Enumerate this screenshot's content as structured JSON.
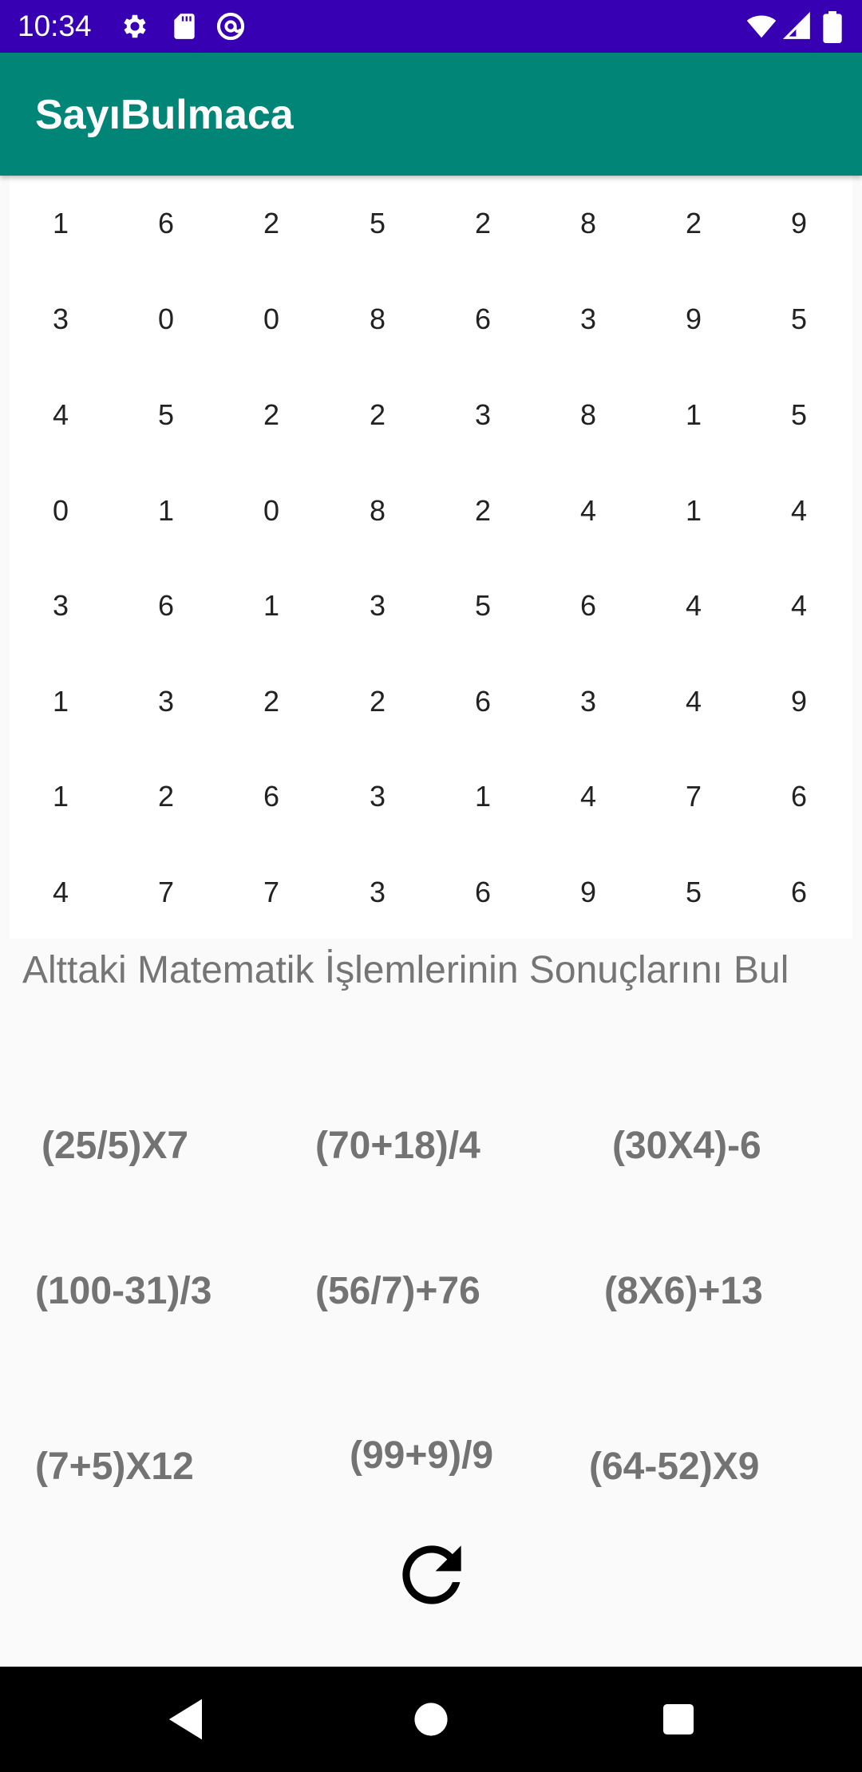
{
  "status_bar": {
    "time": "10:34",
    "left_icons": [
      "gear-icon",
      "sd-card-icon",
      "at-sign-icon"
    ],
    "right_icons": [
      "wifi-icon",
      "signal-icon",
      "battery-icon"
    ],
    "background": "#3700b3"
  },
  "app_bar": {
    "title": "SayıBulmaca",
    "background": "#008577"
  },
  "grid": {
    "rows": [
      [
        "1",
        "6",
        "2",
        "5",
        "2",
        "8",
        "2",
        "9"
      ],
      [
        "3",
        "0",
        "0",
        "8",
        "6",
        "3",
        "9",
        "5"
      ],
      [
        "4",
        "5",
        "2",
        "2",
        "3",
        "8",
        "1",
        "5"
      ],
      [
        "0",
        "1",
        "0",
        "8",
        "2",
        "4",
        "1",
        "4"
      ],
      [
        "3",
        "6",
        "1",
        "3",
        "5",
        "6",
        "4",
        "4"
      ],
      [
        "1",
        "3",
        "2",
        "2",
        "6",
        "3",
        "4",
        "9"
      ],
      [
        "1",
        "2",
        "6",
        "3",
        "1",
        "4",
        "7",
        "6"
      ],
      [
        "4",
        "7",
        "7",
        "3",
        "6",
        "9",
        "5",
        "6"
      ]
    ]
  },
  "instruction": "Alttaki Matematik İşlemlerinin Sonuçlarını Bul",
  "expressions": [
    "(25/5)X7",
    "(70+18)/4",
    "(30X4)-6",
    "(100-31)/3",
    "(56/7)+76",
    "(8X6)+13",
    "(7+5)X12",
    "(99+9)/9",
    "(64-52)X9"
  ],
  "refresh_icon": "refresh-icon",
  "nav_bar": {
    "icons": [
      "back-icon",
      "home-icon",
      "recents-icon"
    ]
  }
}
